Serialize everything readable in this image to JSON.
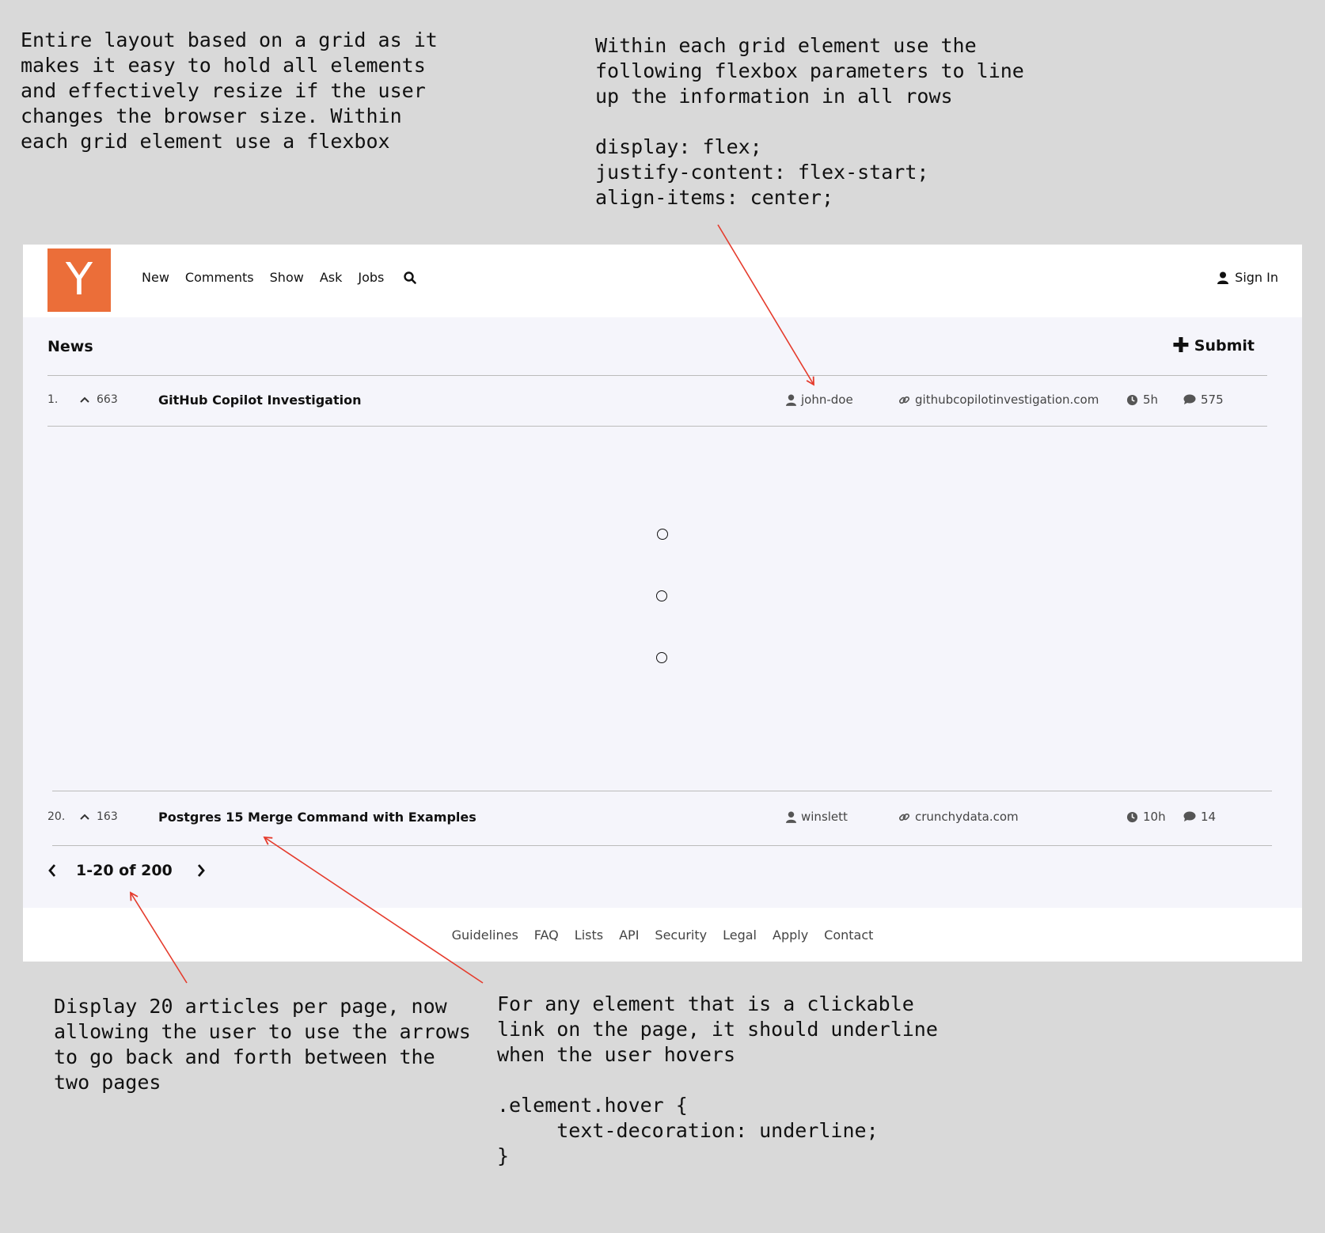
{
  "notes": {
    "grid": "Entire layout based on a grid as it\nmakes it easy to hold all elements\nand effectively resize if the user\nchanges the browser size. Within\neach grid element use a flexbox",
    "flex": "Within each grid element use the\nfollowing flexbox parameters to line\nup the information in all rows\n\ndisplay: flex;\njustify-content: flex-start;\nalign-items: center;",
    "pages": "Display 20 articles per page, now\nallowing the user to use the arrows\nto go back and forth between the\ntwo pages",
    "hover": "For any element that is a clickable\nlink on the page, it should underline\nwhen the user hovers\n\n.element.hover {\n     text-decoration: underline;\n}"
  },
  "header": {
    "logo": "Y",
    "nav": [
      "New",
      "Comments",
      "Show",
      "Ask",
      "Jobs"
    ],
    "signin": "Sign In"
  },
  "section": {
    "title": "News",
    "submit": "Submit"
  },
  "rows": [
    {
      "rank": "1.",
      "votes": "663",
      "title": "GitHub Copilot Investigation",
      "user": "john-doe",
      "domain": "githubcopilotinvestigation.com",
      "time": "5h",
      "comments": "575"
    },
    {
      "rank": "20.",
      "votes": "163",
      "title": "Postgres 15 Merge Command with Examples",
      "user": "winslett",
      "domain": "crunchydata.com",
      "time": "10h",
      "comments": "14"
    }
  ],
  "pager": {
    "label": "1-20 of 200"
  },
  "footer": [
    "Guidelines",
    "FAQ",
    "Lists",
    "API",
    "Security",
    "Legal",
    "Apply",
    "Contact"
  ],
  "colors": {
    "logo": "#eb6e39",
    "annotation_arrow": "#e53b2c",
    "page_bg": "#d9d9d9",
    "content_bg": "#f5f5fb"
  }
}
